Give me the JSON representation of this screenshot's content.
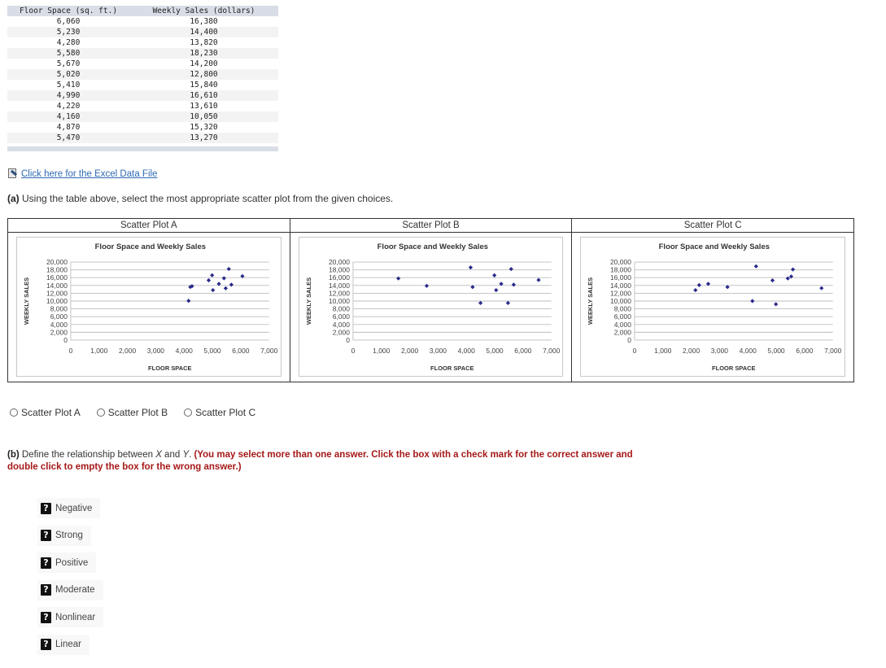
{
  "table": {
    "headers": [
      "Floor Space (sq. ft.)",
      "Weekly Sales (dollars)"
    ],
    "rows": [
      [
        "6,060",
        "16,380"
      ],
      [
        "5,230",
        "14,400"
      ],
      [
        "4,280",
        "13,820"
      ],
      [
        "5,580",
        "18,230"
      ],
      [
        "5,670",
        "14,200"
      ],
      [
        "5,020",
        "12,800"
      ],
      [
        "5,410",
        "15,840"
      ],
      [
        "4,990",
        "16,610"
      ],
      [
        "4,220",
        "13,610"
      ],
      [
        "4,160",
        "10,050"
      ],
      [
        "4,870",
        "15,320"
      ],
      [
        "5,470",
        "13,270"
      ]
    ]
  },
  "excel_link": {
    "label": " Click here for the Excel Data File",
    "icon": "excel-file-icon"
  },
  "question_a": {
    "prefix": "(a)",
    "text": " Using the table above, select the most appropriate scatter plot from the given choices."
  },
  "plots": [
    {
      "cell_title": "Scatter Plot A"
    },
    {
      "cell_title": "Scatter Plot B"
    },
    {
      "cell_title": "Scatter Plot C"
    }
  ],
  "radio_options": [
    "Scatter Plot A",
    "Scatter Plot B",
    "Scatter Plot C"
  ],
  "question_b": {
    "prefix": "(b)",
    "text_1": " Define the relationship between ",
    "x": "X",
    "text_2": " and ",
    "y": "Y",
    "text_3": ". ",
    "instruction": "(You may select more than one answer. Click the box with a check mark for the correct answer and double click to empty the box for the wrong answer.)"
  },
  "check_options": [
    {
      "label": "Negative",
      "state": "unknown",
      "icon": "question-mark-icon"
    },
    {
      "label": "Strong",
      "state": "unknown",
      "icon": "question-mark-icon"
    },
    {
      "label": "Positive",
      "state": "unknown",
      "icon": "question-mark-icon"
    },
    {
      "label": "Moderate",
      "state": "unknown",
      "icon": "question-mark-icon"
    },
    {
      "label": "Nonlinear",
      "state": "unknown",
      "icon": "question-mark-icon"
    },
    {
      "label": "Linear",
      "state": "unknown",
      "icon": "question-mark-icon"
    }
  ],
  "colors": {
    "point": "#2a2a8c",
    "link": "#2f6ab3",
    "instruction": "#a61818",
    "table_header": "#d9dde6"
  },
  "chart_data": [
    {
      "type": "scatter",
      "name": "Scatter Plot A",
      "title": "Floor Space and Weekly Sales",
      "xlabel": "FLOOR SPACE",
      "ylabel": "WEEKLY SALES",
      "xlim": [
        0,
        7000
      ],
      "ylim": [
        0,
        20000
      ],
      "xticks": [
        "0",
        "1,000",
        "2,000",
        "3,000",
        "4,000",
        "5,000",
        "6,000",
        "7,000"
      ],
      "yticks": [
        "20,000",
        "18,000",
        "16,000",
        "14,000",
        "12,000",
        "10,000",
        "8,000",
        "6,000",
        "4,000",
        "2,000",
        "0"
      ],
      "grid": "horizontal",
      "points": [
        [
          6060,
          16380
        ],
        [
          5230,
          14400
        ],
        [
          4280,
          13820
        ],
        [
          5580,
          18230
        ],
        [
          5670,
          14200
        ],
        [
          5020,
          12800
        ],
        [
          5410,
          15840
        ],
        [
          4990,
          16610
        ],
        [
          4220,
          13610
        ],
        [
          4160,
          10050
        ],
        [
          4870,
          15320
        ],
        [
          5470,
          13270
        ]
      ]
    },
    {
      "type": "scatter",
      "name": "Scatter Plot B",
      "title": "Floor Space and Weekly Sales",
      "xlabel": "FLOOR SPACE",
      "ylabel": "WEEKLY SALES",
      "xlim": [
        0,
        7000
      ],
      "ylim": [
        0,
        20000
      ],
      "xticks": [
        "0",
        "1,000",
        "2,000",
        "3,000",
        "4,000",
        "5,000",
        "6,000",
        "7,000"
      ],
      "yticks": [
        "20,000",
        "18,000",
        "16,000",
        "14,000",
        "12,000",
        "10,000",
        "8,000",
        "6,000",
        "4,000",
        "2,000",
        "0"
      ],
      "grid": "horizontal",
      "points": [
        [
          1600,
          15800
        ],
        [
          2600,
          13900
        ],
        [
          4150,
          18600
        ],
        [
          4220,
          13600
        ],
        [
          4500,
          9500
        ],
        [
          4990,
          16600
        ],
        [
          5050,
          12800
        ],
        [
          5230,
          14400
        ],
        [
          5470,
          9500
        ],
        [
          5580,
          18200
        ],
        [
          5670,
          14200
        ],
        [
          6550,
          15400
        ]
      ]
    },
    {
      "type": "scatter",
      "name": "Scatter Plot C",
      "title": "Floor Space and Weekly Sales",
      "xlabel": "FLOOR SPACE",
      "ylabel": "WEEKLY SALES",
      "xlim": [
        0,
        7000
      ],
      "ylim": [
        0,
        20000
      ],
      "xticks": [
        "0",
        "1,000",
        "2,000",
        "3,000",
        "4,000",
        "5,000",
        "6,000",
        "7,000"
      ],
      "yticks": [
        "20,000",
        "18,000",
        "16,000",
        "14,000",
        "12,000",
        "10,000",
        "8,000",
        "6,000",
        "4,000",
        "2,000",
        "0"
      ],
      "grid": "horizontal",
      "points": [
        [
          2150,
          12800
        ],
        [
          2280,
          14100
        ],
        [
          2600,
          14400
        ],
        [
          3280,
          13600
        ],
        [
          4160,
          10000
        ],
        [
          4290,
          18900
        ],
        [
          4870,
          15300
        ],
        [
          4990,
          9200
        ],
        [
          5410,
          15800
        ],
        [
          5530,
          16300
        ],
        [
          5590,
          18100
        ],
        [
          6600,
          13300
        ]
      ]
    }
  ]
}
